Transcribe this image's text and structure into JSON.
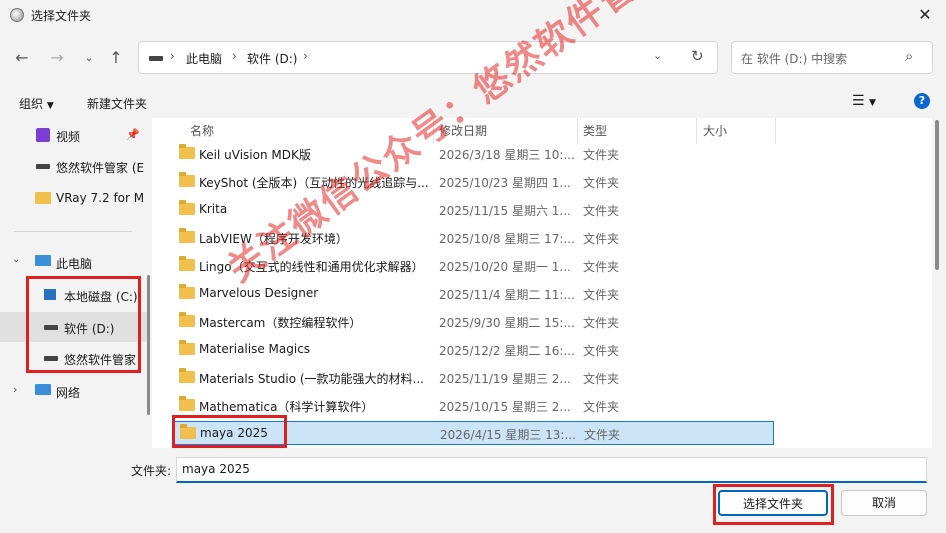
{
  "window": {
    "title": "选择文件夹"
  },
  "address": {
    "segments": [
      "此电脑",
      "软件 (D:)"
    ]
  },
  "search": {
    "placeholder": "在 软件 (D:) 中搜索"
  },
  "toolbar": {
    "organize_label": "组织",
    "new_folder_label": "新建文件夹"
  },
  "nav": {
    "quick": [
      {
        "label": "视频"
      },
      {
        "label": "悠然软件管家 (E"
      },
      {
        "label": "VRay 7.2 for M"
      }
    ],
    "this_pc": "此电脑",
    "drives": [
      {
        "label": "本地磁盘 (C:)"
      },
      {
        "label": "软件 (D:)"
      },
      {
        "label": "悠然软件管家"
      }
    ],
    "network": "网络"
  },
  "columns": {
    "name": "名称",
    "date": "修改日期",
    "type": "类型",
    "size": "大小"
  },
  "files": [
    {
      "name": "Keil uVision MDK版",
      "date": "2026/3/18 星期三 10:...",
      "type": "文件夹"
    },
    {
      "name": "KeyShot (全版本)（互动性的光线追踪与...",
      "date": "2025/10/23 星期四 1...",
      "type": "文件夹"
    },
    {
      "name": "Krita",
      "date": "2025/11/15 星期六 1...",
      "type": "文件夹"
    },
    {
      "name": "LabVIEW（程序开发环境）",
      "date": "2025/10/8 星期三 17:...",
      "type": "文件夹"
    },
    {
      "name": "Lingo（交互式的线性和通用优化求解器）",
      "date": "2025/10/20 星期一 1...",
      "type": "文件夹"
    },
    {
      "name": "Marvelous Designer",
      "date": "2025/11/4 星期二 11:...",
      "type": "文件夹"
    },
    {
      "name": "Mastercam（数控编程软件）",
      "date": "2025/9/30 星期二 15:...",
      "type": "文件夹"
    },
    {
      "name": "Materialise Magics",
      "date": "2025/12/2 星期二 16:...",
      "type": "文件夹"
    },
    {
      "name": "Materials Studio (一款功能强大的材料...",
      "date": "2025/11/19 星期三 2...",
      "type": "文件夹"
    },
    {
      "name": "Mathematica（科学计算软件）",
      "date": "2025/10/15 星期三 2...",
      "type": "文件夹"
    },
    {
      "name": "maya 2025",
      "date": "2026/4/15 星期三 13:...",
      "type": "文件夹",
      "selected": true
    }
  ],
  "footer": {
    "folder_label": "文件夹:",
    "folder_value": "maya 2025",
    "select_button": "选择文件夹",
    "cancel_button": "取消"
  },
  "watermark": "关注微信公众号：悠然软件管家",
  "colors": {
    "accent": "#0067c0",
    "highlight": "#e02020",
    "selected_bg": "#cce4f7",
    "folder": "#f1c04c"
  }
}
